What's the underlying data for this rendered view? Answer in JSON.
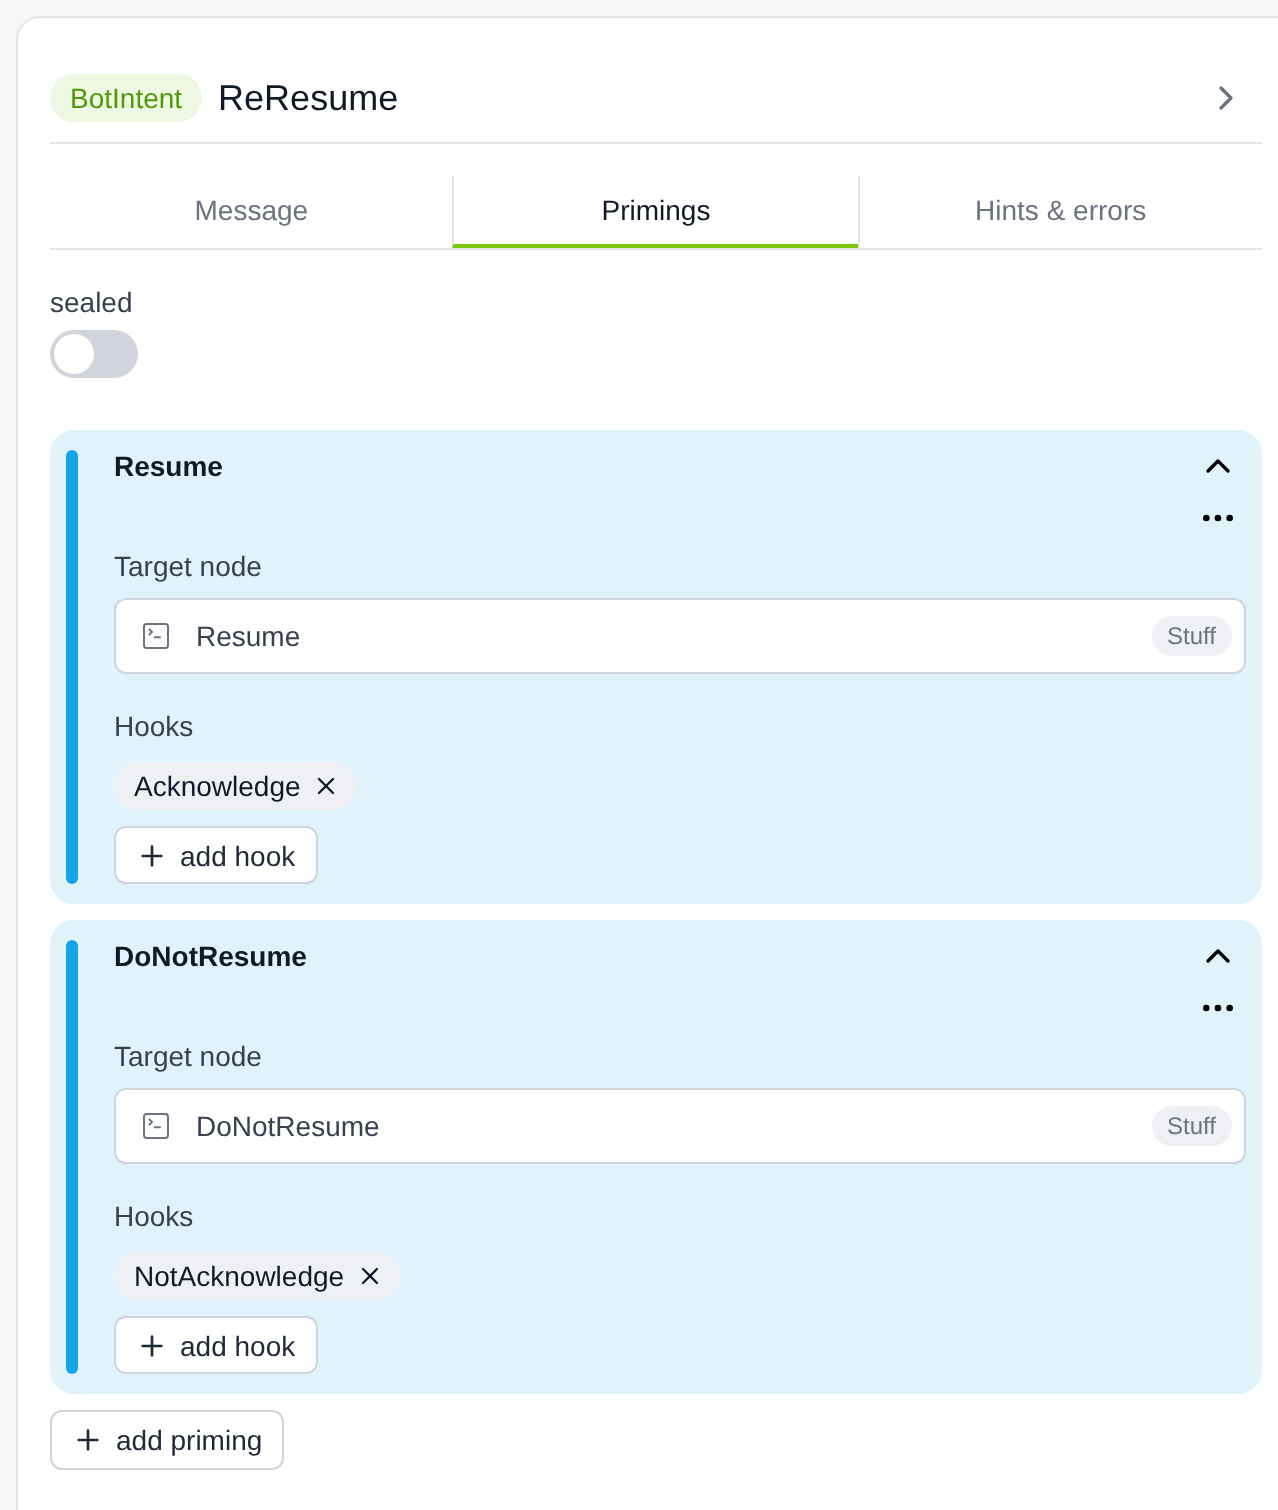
{
  "header": {
    "badge": "BotIntent",
    "title": "ReResume"
  },
  "tabs": [
    {
      "label": "Message",
      "selected": false
    },
    {
      "label": "Primings",
      "selected": true
    },
    {
      "label": "Hints & errors",
      "selected": false
    }
  ],
  "sealed": {
    "label": "sealed",
    "on": false
  },
  "primings": [
    {
      "name": "Resume",
      "expanded": true,
      "target_label": "Target node",
      "target": "Resume",
      "target_tag": "Stuff",
      "hooks_label": "Hooks",
      "hooks": [
        "Acknowledge"
      ],
      "add_hook": "add hook"
    },
    {
      "name": "DoNotResume",
      "expanded": true,
      "target_label": "Target node",
      "target": "DoNotResume",
      "target_tag": "Stuff",
      "hooks_label": "Hooks",
      "hooks": [
        "NotAcknowledge"
      ],
      "add_hook": "add hook"
    }
  ],
  "add_priming": "add priming"
}
